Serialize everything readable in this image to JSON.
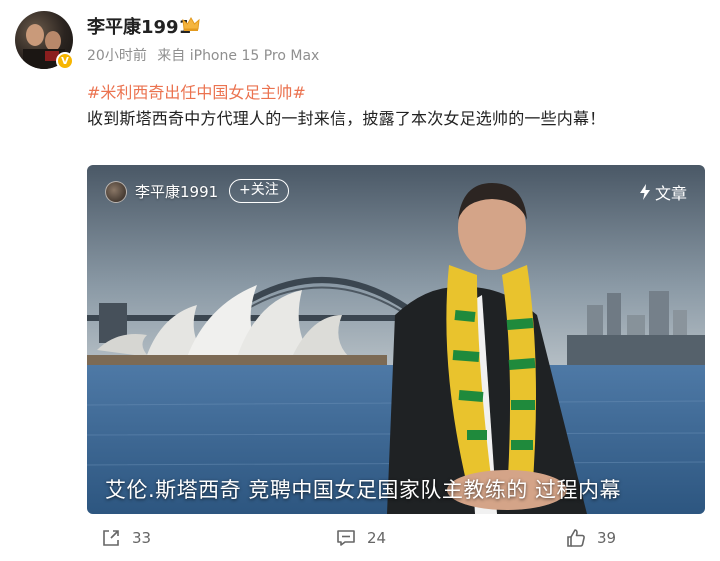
{
  "post": {
    "username": "李平康1991",
    "time": "20小时前",
    "source": "来自 iPhone 15 Pro Max",
    "hashtag": "#米利西奇出任中国女足主帅#",
    "text": "收到斯塔西奇中方代理人的一封来信，披露了本次女足选帅的一些内幕！"
  },
  "card": {
    "username": "李平康1991",
    "follow_label": "+关注",
    "article_label": "文章",
    "caption": "艾伦.斯塔西奇 竞聘中国女足国家队主教练的 过程内幕"
  },
  "actions": {
    "share_count": "33",
    "comment_count": "24",
    "like_count": "39"
  },
  "colors": {
    "hashtag": "#eb7350",
    "meta": "#8f8f8f",
    "verified_badge": "#f7b500"
  },
  "icons": [
    "verified-badge-icon",
    "crown-icon",
    "lightning-icon",
    "share-icon",
    "comment-icon",
    "like-icon"
  ]
}
